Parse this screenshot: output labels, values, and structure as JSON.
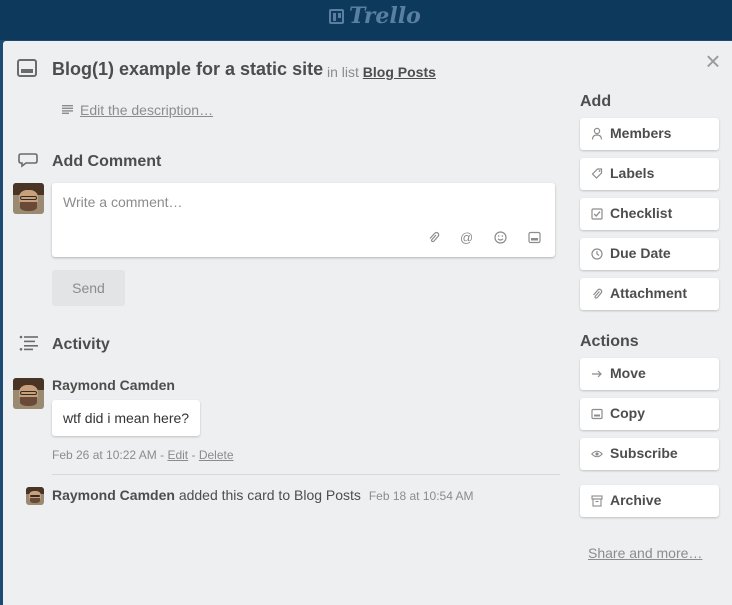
{
  "header": {
    "logo_text": "Trello"
  },
  "card": {
    "title": "Blog(1) example for a static site",
    "in_list_prefix": "in list",
    "list_name": "Blog Posts",
    "description_link": "Edit the description…"
  },
  "comment": {
    "heading": "Add Comment",
    "placeholder": "Write a comment…",
    "send_label": "Send",
    "tool_icons": [
      "paperclip-icon",
      "mention-icon",
      "emoji-icon",
      "card-icon"
    ]
  },
  "activity": {
    "heading": "Activity",
    "comment_item": {
      "author": "Raymond Camden",
      "text": "wtf did i mean here?",
      "timestamp": "Feb 26 at 10:22 AM",
      "separator": "-",
      "edit_label": "Edit",
      "delete_label": "Delete"
    },
    "log_item": {
      "author": "Raymond Camden",
      "action": "added this card to Blog Posts",
      "timestamp": "Feb 18 at 10:54 AM"
    }
  },
  "sidebar": {
    "add_heading": "Add",
    "add_items": [
      {
        "label": "Members",
        "icon": "person-icon"
      },
      {
        "label": "Labels",
        "icon": "tag-icon"
      },
      {
        "label": "Checklist",
        "icon": "checkbox-icon"
      },
      {
        "label": "Due Date",
        "icon": "clock-icon"
      },
      {
        "label": "Attachment",
        "icon": "paperclip-icon"
      }
    ],
    "actions_heading": "Actions",
    "action_items": [
      {
        "label": "Move",
        "icon": "arrow-right-icon"
      },
      {
        "label": "Copy",
        "icon": "card-icon"
      },
      {
        "label": "Subscribe",
        "icon": "eye-icon"
      },
      {
        "label": "Archive",
        "icon": "archive-icon"
      }
    ],
    "share_link": "Share and more…"
  },
  "colors": {
    "header_bg": "#0d3a5c",
    "modal_bg": "#edeff0",
    "text": "#4d4d4d",
    "muted": "#8c8c8c"
  }
}
